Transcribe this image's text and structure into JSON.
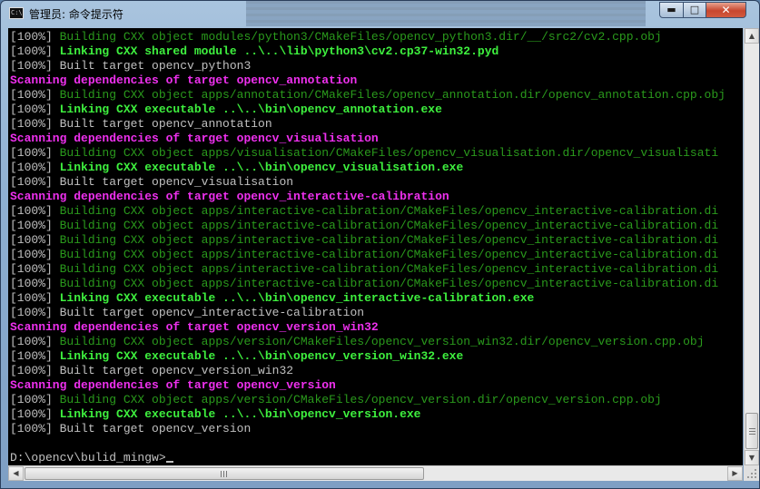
{
  "window": {
    "title": "管理员: 命令提示符",
    "icon_label": "C:\\",
    "controls": {
      "minimize": "▬",
      "maximize": "□",
      "close": "✕"
    }
  },
  "console": {
    "lines": [
      {
        "prefix": "[100%]",
        "type": "build",
        "text": " Building CXX object modules/python3/CMakeFiles/opencv_python3.dir/__/src2/cv2.cpp.obj"
      },
      {
        "prefix": "[100%]",
        "type": "link",
        "text": " Linking CXX shared module ..\\..\\lib\\python3\\cv2.cp37-win32.pyd"
      },
      {
        "prefix": "[100%]",
        "type": "built",
        "text": " Built target opencv_python3"
      },
      {
        "prefix": "",
        "type": "scan",
        "text": "Scanning dependencies of target opencv_annotation"
      },
      {
        "prefix": "[100%]",
        "type": "build",
        "text": " Building CXX object apps/annotation/CMakeFiles/opencv_annotation.dir/opencv_annotation.cpp.obj"
      },
      {
        "prefix": "[100%]",
        "type": "link",
        "text": " Linking CXX executable ..\\..\\bin\\opencv_annotation.exe"
      },
      {
        "prefix": "[100%]",
        "type": "built",
        "text": " Built target opencv_annotation"
      },
      {
        "prefix": "",
        "type": "scan",
        "text": "Scanning dependencies of target opencv_visualisation"
      },
      {
        "prefix": "[100%]",
        "type": "build",
        "text": " Building CXX object apps/visualisation/CMakeFiles/opencv_visualisation.dir/opencv_visualisati"
      },
      {
        "prefix": "[100%]",
        "type": "link",
        "text": " Linking CXX executable ..\\..\\bin\\opencv_visualisation.exe"
      },
      {
        "prefix": "[100%]",
        "type": "built",
        "text": " Built target opencv_visualisation"
      },
      {
        "prefix": "",
        "type": "scan",
        "text": "Scanning dependencies of target opencv_interactive-calibration"
      },
      {
        "prefix": "[100%]",
        "type": "build",
        "text": " Building CXX object apps/interactive-calibration/CMakeFiles/opencv_interactive-calibration.di"
      },
      {
        "prefix": "[100%]",
        "type": "build",
        "text": " Building CXX object apps/interactive-calibration/CMakeFiles/opencv_interactive-calibration.di"
      },
      {
        "prefix": "[100%]",
        "type": "build",
        "text": " Building CXX object apps/interactive-calibration/CMakeFiles/opencv_interactive-calibration.di"
      },
      {
        "prefix": "[100%]",
        "type": "build",
        "text": " Building CXX object apps/interactive-calibration/CMakeFiles/opencv_interactive-calibration.di"
      },
      {
        "prefix": "[100%]",
        "type": "build",
        "text": " Building CXX object apps/interactive-calibration/CMakeFiles/opencv_interactive-calibration.di"
      },
      {
        "prefix": "[100%]",
        "type": "build",
        "text": " Building CXX object apps/interactive-calibration/CMakeFiles/opencv_interactive-calibration.di"
      },
      {
        "prefix": "[100%]",
        "type": "link",
        "text": " Linking CXX executable ..\\..\\bin\\opencv_interactive-calibration.exe"
      },
      {
        "prefix": "[100%]",
        "type": "built",
        "text": " Built target opencv_interactive-calibration"
      },
      {
        "prefix": "",
        "type": "scan",
        "text": "Scanning dependencies of target opencv_version_win32"
      },
      {
        "prefix": "[100%]",
        "type": "build",
        "text": " Building CXX object apps/version/CMakeFiles/opencv_version_win32.dir/opencv_version.cpp.obj"
      },
      {
        "prefix": "[100%]",
        "type": "link",
        "text": " Linking CXX executable ..\\..\\bin\\opencv_version_win32.exe"
      },
      {
        "prefix": "[100%]",
        "type": "built",
        "text": " Built target opencv_version_win32"
      },
      {
        "prefix": "",
        "type": "scan",
        "text": "Scanning dependencies of target opencv_version"
      },
      {
        "prefix": "[100%]",
        "type": "build",
        "text": " Building CXX object apps/version/CMakeFiles/opencv_version.dir/opencv_version.cpp.obj"
      },
      {
        "prefix": "[100%]",
        "type": "link",
        "text": " Linking CXX executable ..\\..\\bin\\opencv_version.exe"
      },
      {
        "prefix": "[100%]",
        "type": "built",
        "text": " Built target opencv_version"
      }
    ],
    "prompt": "D:\\opencv\\bulid_mingw>"
  },
  "scrollbars": {
    "up": "▲",
    "down": "▼",
    "left": "◀",
    "right": "▶"
  },
  "colors": {
    "build": "#2a9a1c",
    "link": "#3ef03e",
    "scan": "#ee30ee",
    "plain": "#c0c0c0",
    "background": "#000000"
  }
}
